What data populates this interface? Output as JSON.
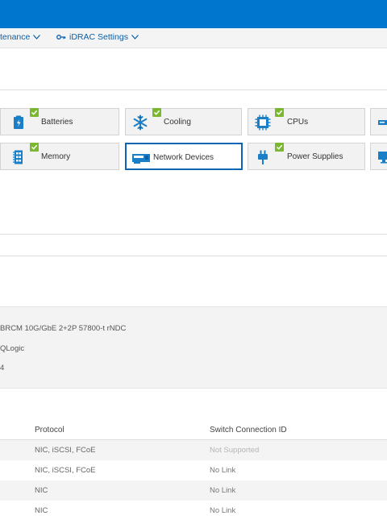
{
  "nav": {
    "maintenance_label": "tenance",
    "idrac_settings_label": "iDRAC Settings"
  },
  "tiles": {
    "batteries": "Batteries",
    "cooling": "Cooling",
    "cpus": "CPUs",
    "memory": "Memory",
    "network_devices": "Network Devices",
    "power_supplies": "Power Supplies"
  },
  "device_info": {
    "product_name": "BRCM 10G/GbE 2+2P 57800-t rNDC",
    "vendor": "QLogic",
    "fragment": "4"
  },
  "ports_table": {
    "headers": {
      "protocol": "Protocol",
      "switch_connection_id": "Switch Connection ID"
    },
    "rows": [
      {
        "protocol": "NIC, iSCSI, FCoE",
        "switch_connection_id": "Not Supported"
      },
      {
        "protocol": "NIC, iSCSI, FCoE",
        "switch_connection_id": "No Link"
      },
      {
        "protocol": "NIC",
        "switch_connection_id": "No Link"
      },
      {
        "protocol": "NIC",
        "switch_connection_id": "No Link"
      }
    ]
  },
  "colors": {
    "header_blue": "#0076ce",
    "link_blue": "#0b5ea8",
    "status_ok_green": "#7cb82f",
    "selected_border": "#0b64b7"
  },
  "icons": [
    "chevron-down-icon",
    "key-icon",
    "battery-icon",
    "snowflake-icon",
    "cpu-icon",
    "memory-icon",
    "network-card-icon",
    "power-plug-icon",
    "check-icon"
  ]
}
